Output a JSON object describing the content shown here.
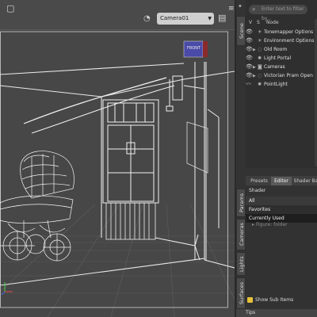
{
  "viewport": {
    "camera_select": "Camera01",
    "cube_label": "FRONT"
  },
  "right_panel": {
    "scene_tab": "Scene",
    "filter_placeholder": "Enter text to filter by...",
    "columns": {
      "v": "V",
      "s": "S",
      "node": "Node"
    },
    "nodes": [
      {
        "label": "Tonemapper Options",
        "icon": "sun-icon",
        "expandable": false
      },
      {
        "label": "Environment Options",
        "icon": "sun-icon",
        "expandable": false
      },
      {
        "label": "Old Room",
        "icon": "figure-icon",
        "expandable": true
      },
      {
        "label": "Light Portal",
        "icon": "light-icon",
        "expandable": false
      },
      {
        "label": "Cameras",
        "icon": "camera-icon",
        "expandable": true
      },
      {
        "label": "Victorian Pram Open",
        "icon": "figure-icon",
        "expandable": true
      },
      {
        "label": "PointLight",
        "icon": "light-icon",
        "expandable": false
      }
    ],
    "lower_tabs": [
      "Presets",
      "Editor",
      "Shader Ba"
    ],
    "side_tabs": [
      "Params",
      "Cameras",
      "Lights",
      "Surfaces"
    ],
    "shader_label": "Shader",
    "shader_list": [
      "All",
      "Favorites",
      "Currently Used"
    ],
    "path_text": "Figure: folder",
    "show_sub_items": "Show Sub Items",
    "tips": "Tips"
  }
}
